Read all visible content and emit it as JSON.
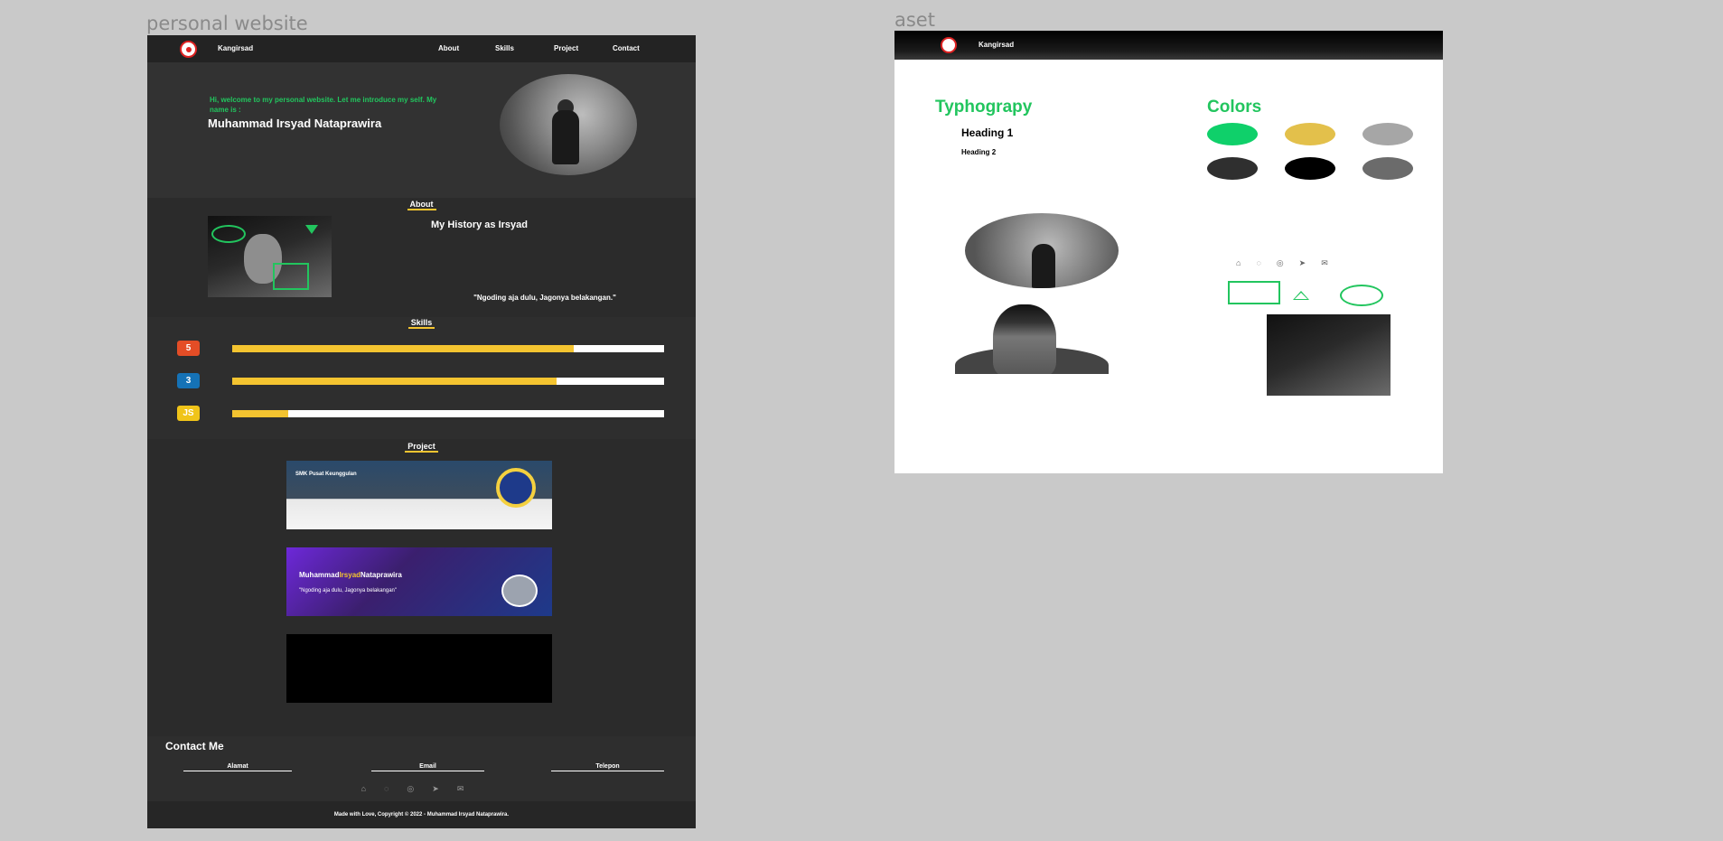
{
  "frames": {
    "personal_label": "personal website",
    "aset_label": "aset"
  },
  "site": {
    "brand": "Kangirsad",
    "nav": [
      "About",
      "Skills",
      "Project",
      "Contact"
    ],
    "hero": {
      "greeting": "Hi, welcome to my personal website. Let me introduce my self. My name is :",
      "name": "Muhammad Irsyad Nataprawira"
    },
    "about": {
      "title": "About",
      "heading": "My History as Irsyad",
      "quote": "\"Ngoding aja dulu, Jagonya belakangan.\""
    },
    "skills": {
      "title": "Skills",
      "items": [
        {
          "icon": "html5-icon",
          "glyph": "5",
          "color": "#e44d26",
          "level": 0.79
        },
        {
          "icon": "css3-icon",
          "glyph": "3",
          "color": "#1572b6",
          "level": 0.75
        },
        {
          "icon": "js-icon",
          "glyph": "JS",
          "color": "#f0c419",
          "level": 0.13
        }
      ]
    },
    "projects": {
      "title": "Project",
      "shot1_title": "SMK Pusat Keunggulan",
      "shot2_name_a": "Muhammad",
      "shot2_name_b": "Irsyad",
      "shot2_name_c": "Nataprawira",
      "shot2_quote": "\"Ngoding aja dulu, Jagonya belakangan\""
    },
    "contact": {
      "title": "Contact Me",
      "columns": [
        {
          "label": "Alamat"
        },
        {
          "label": "Email"
        },
        {
          "label": "Telepon"
        }
      ]
    },
    "footer": "Made with Love, Copyright © 2022 - Muhammad Irsyad Nataprawira."
  },
  "aset": {
    "brand": "Kangirsad",
    "typography_title": "Typhograpy",
    "heading1": "Heading 1",
    "heading2": "Heading 2",
    "colors_title": "Colors",
    "swatches": [
      "#0fd06a",
      "#e3c04b",
      "#a6a6a6",
      "#2f2f2f",
      "#000000",
      "#6b6b6b"
    ]
  }
}
